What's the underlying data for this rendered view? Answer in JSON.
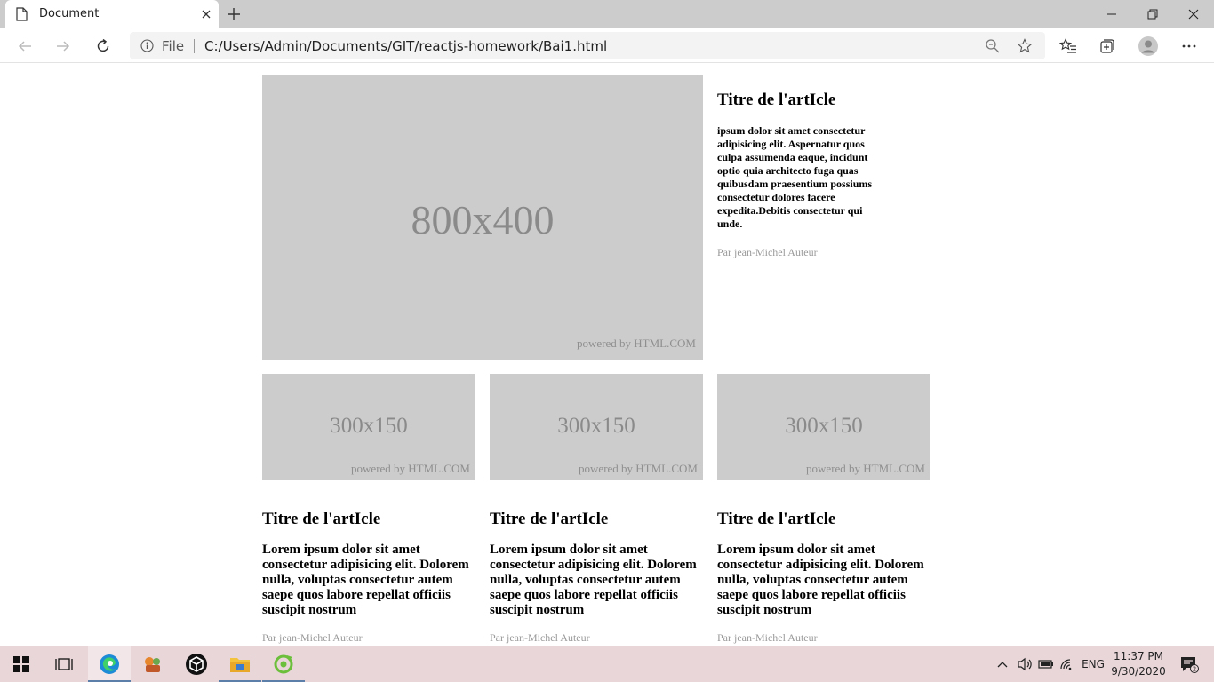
{
  "browser": {
    "tab_title": "Document",
    "address_scheme": "File",
    "url": "C:/Users/Admin/Documents/GIT/reactjs-homework/Bai1.html"
  },
  "hero": {
    "image_size": "800x400",
    "powered_by": "powered by HTML.COM",
    "title": "Titre de l'artIcle",
    "body": "ipsum dolor sit amet consectetur adipisicing elit. Aspernatur quos culpa assumenda eaque, incidunt optio quia architecto fuga quas quibusdam praesentium possiums consectetur dolores facere expedita.Debitis consectetur qui unde.",
    "author": "Par jean-Michel Auteur"
  },
  "cards": [
    {
      "image_size": "300x150",
      "powered_by": "powered by HTML.COM",
      "title": "Titre de l'artIcle",
      "body": "Lorem ipsum dolor sit amet consectetur adipisicing elit. Dolorem nulla, voluptas consectetur autem saepe quos labore repellat officiis suscipit nostrum",
      "author": "Par jean-Michel Auteur"
    },
    {
      "image_size": "300x150",
      "powered_by": "powered by HTML.COM",
      "title": "Titre de l'artIcle",
      "body": "Lorem ipsum dolor sit amet consectetur adipisicing elit. Dolorem nulla, voluptas consectetur autem saepe quos labore repellat officiis suscipit nostrum",
      "author": "Par jean-Michel Auteur"
    },
    {
      "image_size": "300x150",
      "powered_by": "powered by HTML.COM",
      "title": "Titre de l'artIcle",
      "body": "Lorem ipsum dolor sit amet consectetur adipisicing elit. Dolorem nulla, voluptas consectetur autem saepe quos labore repellat officiis suscipit nostrum",
      "author": "Par jean-Michel Auteur"
    }
  ],
  "taskbar": {
    "apps": [
      "start-icon",
      "task-view-icon",
      "edge-icon",
      "app-icon",
      "unity-icon",
      "file-explorer-icon",
      "app-icon"
    ],
    "language": "ENG",
    "time": "11:37 PM",
    "date": "9/30/2020",
    "notification_count": "2"
  }
}
